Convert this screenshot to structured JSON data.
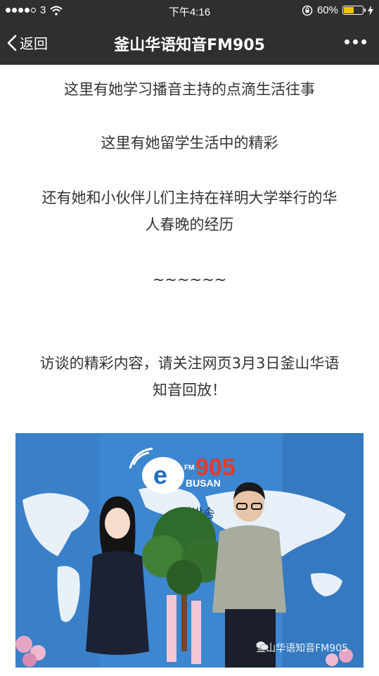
{
  "status_bar": {
    "carrier": "3",
    "time": "下午4:16",
    "battery": "60%",
    "battery_level": 0.6
  },
  "nav": {
    "back_label": "返回",
    "title": "釜山华语知音FM905"
  },
  "article": {
    "p1": "这里有她学习播音主持的点滴生活往事",
    "p2": "这里有她留学生活中的精彩",
    "p3_line1": "还有她和小伙伴儿们主持在祥明大学举行的华",
    "p3_line2": "人春晚的经历",
    "p4": "~~~~~~",
    "p5_line1": "访谈的精彩内容，请关注网页3月3日釜山华语",
    "p5_line2": "知音回放！"
  },
  "photo": {
    "logo_number": "905",
    "logo_fm": "FM",
    "logo_city": "BUSAN",
    "korean_sign": "어방송",
    "watermark": "釜山华语知音FM905"
  },
  "colors": {
    "bar_bg": "#2f2f2f",
    "text": "#333333",
    "battery": "#f5c400",
    "studio_blue": "#3a82cc"
  }
}
